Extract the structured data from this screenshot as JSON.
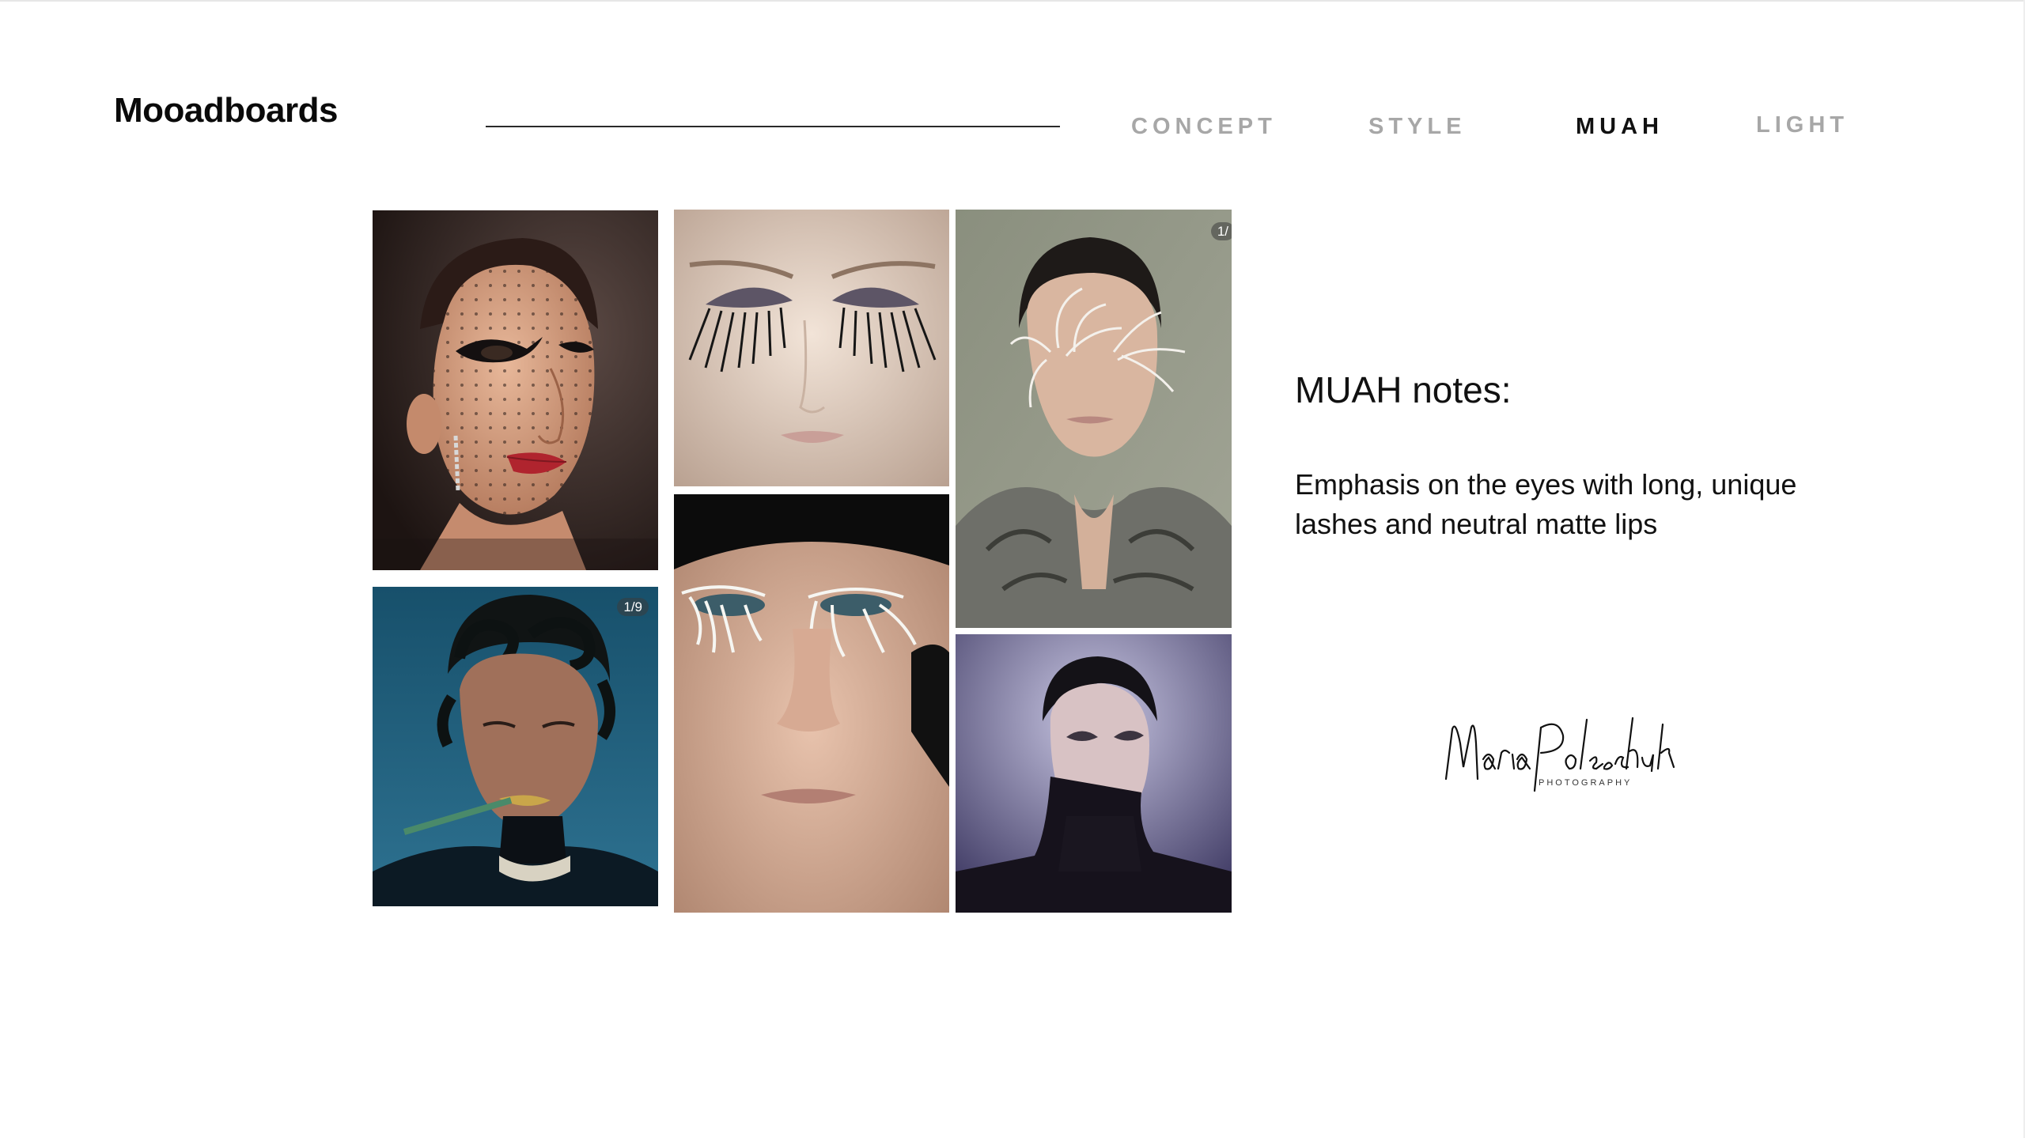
{
  "header": {
    "title": "Mooadboards",
    "nav": [
      {
        "label": "CONCEPT",
        "active": false
      },
      {
        "label": "STYLE",
        "active": false
      },
      {
        "label": "MUAH",
        "active": true
      },
      {
        "label": "LIGHT",
        "active": false
      }
    ]
  },
  "gallery": {
    "photos": [
      {
        "name": "photo-dotted-face-graphic-liner"
      },
      {
        "name": "photo-long-feather-lashes"
      },
      {
        "name": "photo-white-fiber-eye-art"
      },
      {
        "name": "photo-sculpted-wave-hair",
        "counter": "1/9"
      },
      {
        "name": "photo-white-lash-closeup"
      },
      {
        "name": "photo-purple-studio-portrait"
      }
    ],
    "edge_counter": "1/"
  },
  "notes": {
    "title": "MUAH notes:",
    "body": "Emphasis on the eyes with long, unique lashes and neutral matte lips"
  },
  "signature": {
    "name": "Maria Poleshchuk",
    "subtitle": "PHOTOGRAPHY"
  },
  "colors": {
    "nav_inactive": "#a7a7a7",
    "nav_active": "#111111",
    "text": "#111111"
  }
}
